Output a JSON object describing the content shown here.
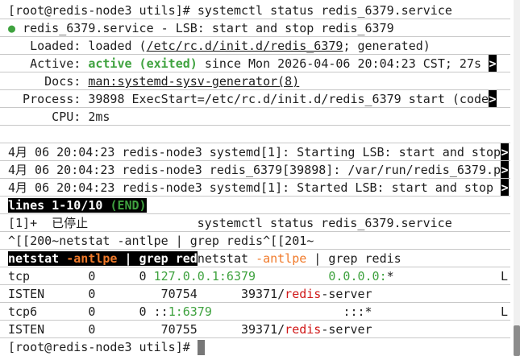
{
  "prompt1": {
    "text": "[root@redis-node3 utils]# ",
    "cmd": "systemctl status redis_6379.service"
  },
  "status": {
    "unit_line": "redis_6379.service - LSB: start and stop redis_6379",
    "loaded_label": "   Loaded: ",
    "loaded_pre": "loaded (",
    "loaded_path": "/etc/rc.d/init.d/redis_6379",
    "loaded_post": "; generated)",
    "active_label": "   Active: ",
    "active_state": "active (exited)",
    "active_rest": " since Mon 2026-04-06 20:04:23 CST; 27s ",
    "docs_label": "     Docs: ",
    "docs_value": "man:systemd-sysv-generator(8)",
    "process_label": "  Process: ",
    "process_value": "39898 ExecStart=/etc/rc.d/init.d/redis_6379 start (code",
    "cpu_label": "      CPU: ",
    "cpu_value": "2ms"
  },
  "journal": [
    "4月 06 20:04:23 redis-node3 systemd[1]: Starting LSB: start and stop",
    "4月 06 20:04:23 redis-node3 redis_6379[39898]: /var/run/redis_6379.p",
    "4月 06 20:04:23 redis-node3 systemd[1]: Started LSB: start and stop "
  ],
  "pager": {
    "lines": "lines 1-10/10 ",
    "end": "(END)"
  },
  "job": {
    "text": "[1]+  已停止               systemctl status redis_6379.service"
  },
  "paste_line": "^[[200~netstat -antlpe | grep redis^[[201~",
  "cmdline": {
    "blk1": "netstat ",
    "blk_opt": "-antlpe",
    "blk2": " | grep red",
    "p1": "netstat ",
    "p_opt": "-antlpe",
    "p2": " | grep redis"
  },
  "netstat": [
    {
      "c1": "tcp        0      0 ",
      "addr_green": "127.0.0.1:6379",
      "gap": "          ",
      "foreign": "0.0.0.0:",
      "foreign_tail": "*",
      "state": "L"
    },
    {
      "c1": "ISTEN      0         70754      39371/",
      "prog_red": "redis",
      "prog_rest": "-server"
    },
    {
      "c1": "tcp6       0      0 ::",
      "addr_green": "1:6379",
      "gap": "                  ",
      "foreign": ":::",
      "foreign_tail": "*",
      "state": "L"
    },
    {
      "c1": "ISTEN      0         70755      39371/",
      "prog_red": "redis",
      "prog_rest": "-server"
    }
  ],
  "prompt2": {
    "text": "[root@redis-node3 utils]# "
  },
  "truncation_marker": ">",
  "bullet": "●"
}
